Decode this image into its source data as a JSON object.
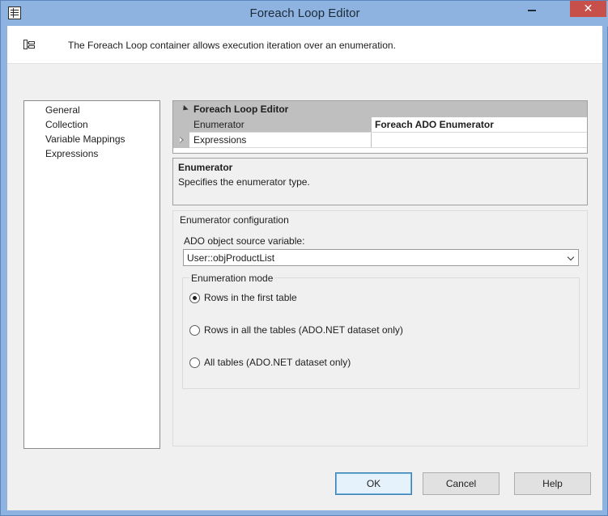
{
  "window": {
    "title": "Foreach Loop Editor",
    "minimize_glyph": "—",
    "close_glyph": "✕"
  },
  "header": {
    "description": "The Foreach Loop container allows execution iteration over an enumeration.",
    "icon": "container-icon"
  },
  "nav": {
    "items": [
      {
        "label": "General"
      },
      {
        "label": "Collection"
      },
      {
        "label": "Variable Mappings"
      },
      {
        "label": "Expressions"
      }
    ],
    "selected": "Collection"
  },
  "property_grid": {
    "category": "Foreach Loop Editor",
    "rows": [
      {
        "name": "Enumerator",
        "value": "Foreach ADO Enumerator",
        "selected": true
      },
      {
        "name": "Expressions",
        "value": "",
        "expandable": true
      }
    ]
  },
  "description_box": {
    "title": "Enumerator",
    "text": "Specifies the enumerator type."
  },
  "config": {
    "caption": "Enumerator configuration",
    "source_label": "ADO object source variable:",
    "source_value": "User::objProductList",
    "mode_caption": "Enumeration mode",
    "modes": [
      {
        "label": "Rows in the first table",
        "checked": true
      },
      {
        "label": "Rows in all the tables (ADO.NET dataset only)",
        "checked": false
      },
      {
        "label": "All tables (ADO.NET dataset only)",
        "checked": false
      }
    ]
  },
  "buttons": {
    "ok": "OK",
    "cancel": "Cancel",
    "help": "Help"
  },
  "colors": {
    "titlebar": "#8fb3e0",
    "close": "#c7504a",
    "panel": "#f0f0f0",
    "grid_category": "#bfbfbf"
  }
}
